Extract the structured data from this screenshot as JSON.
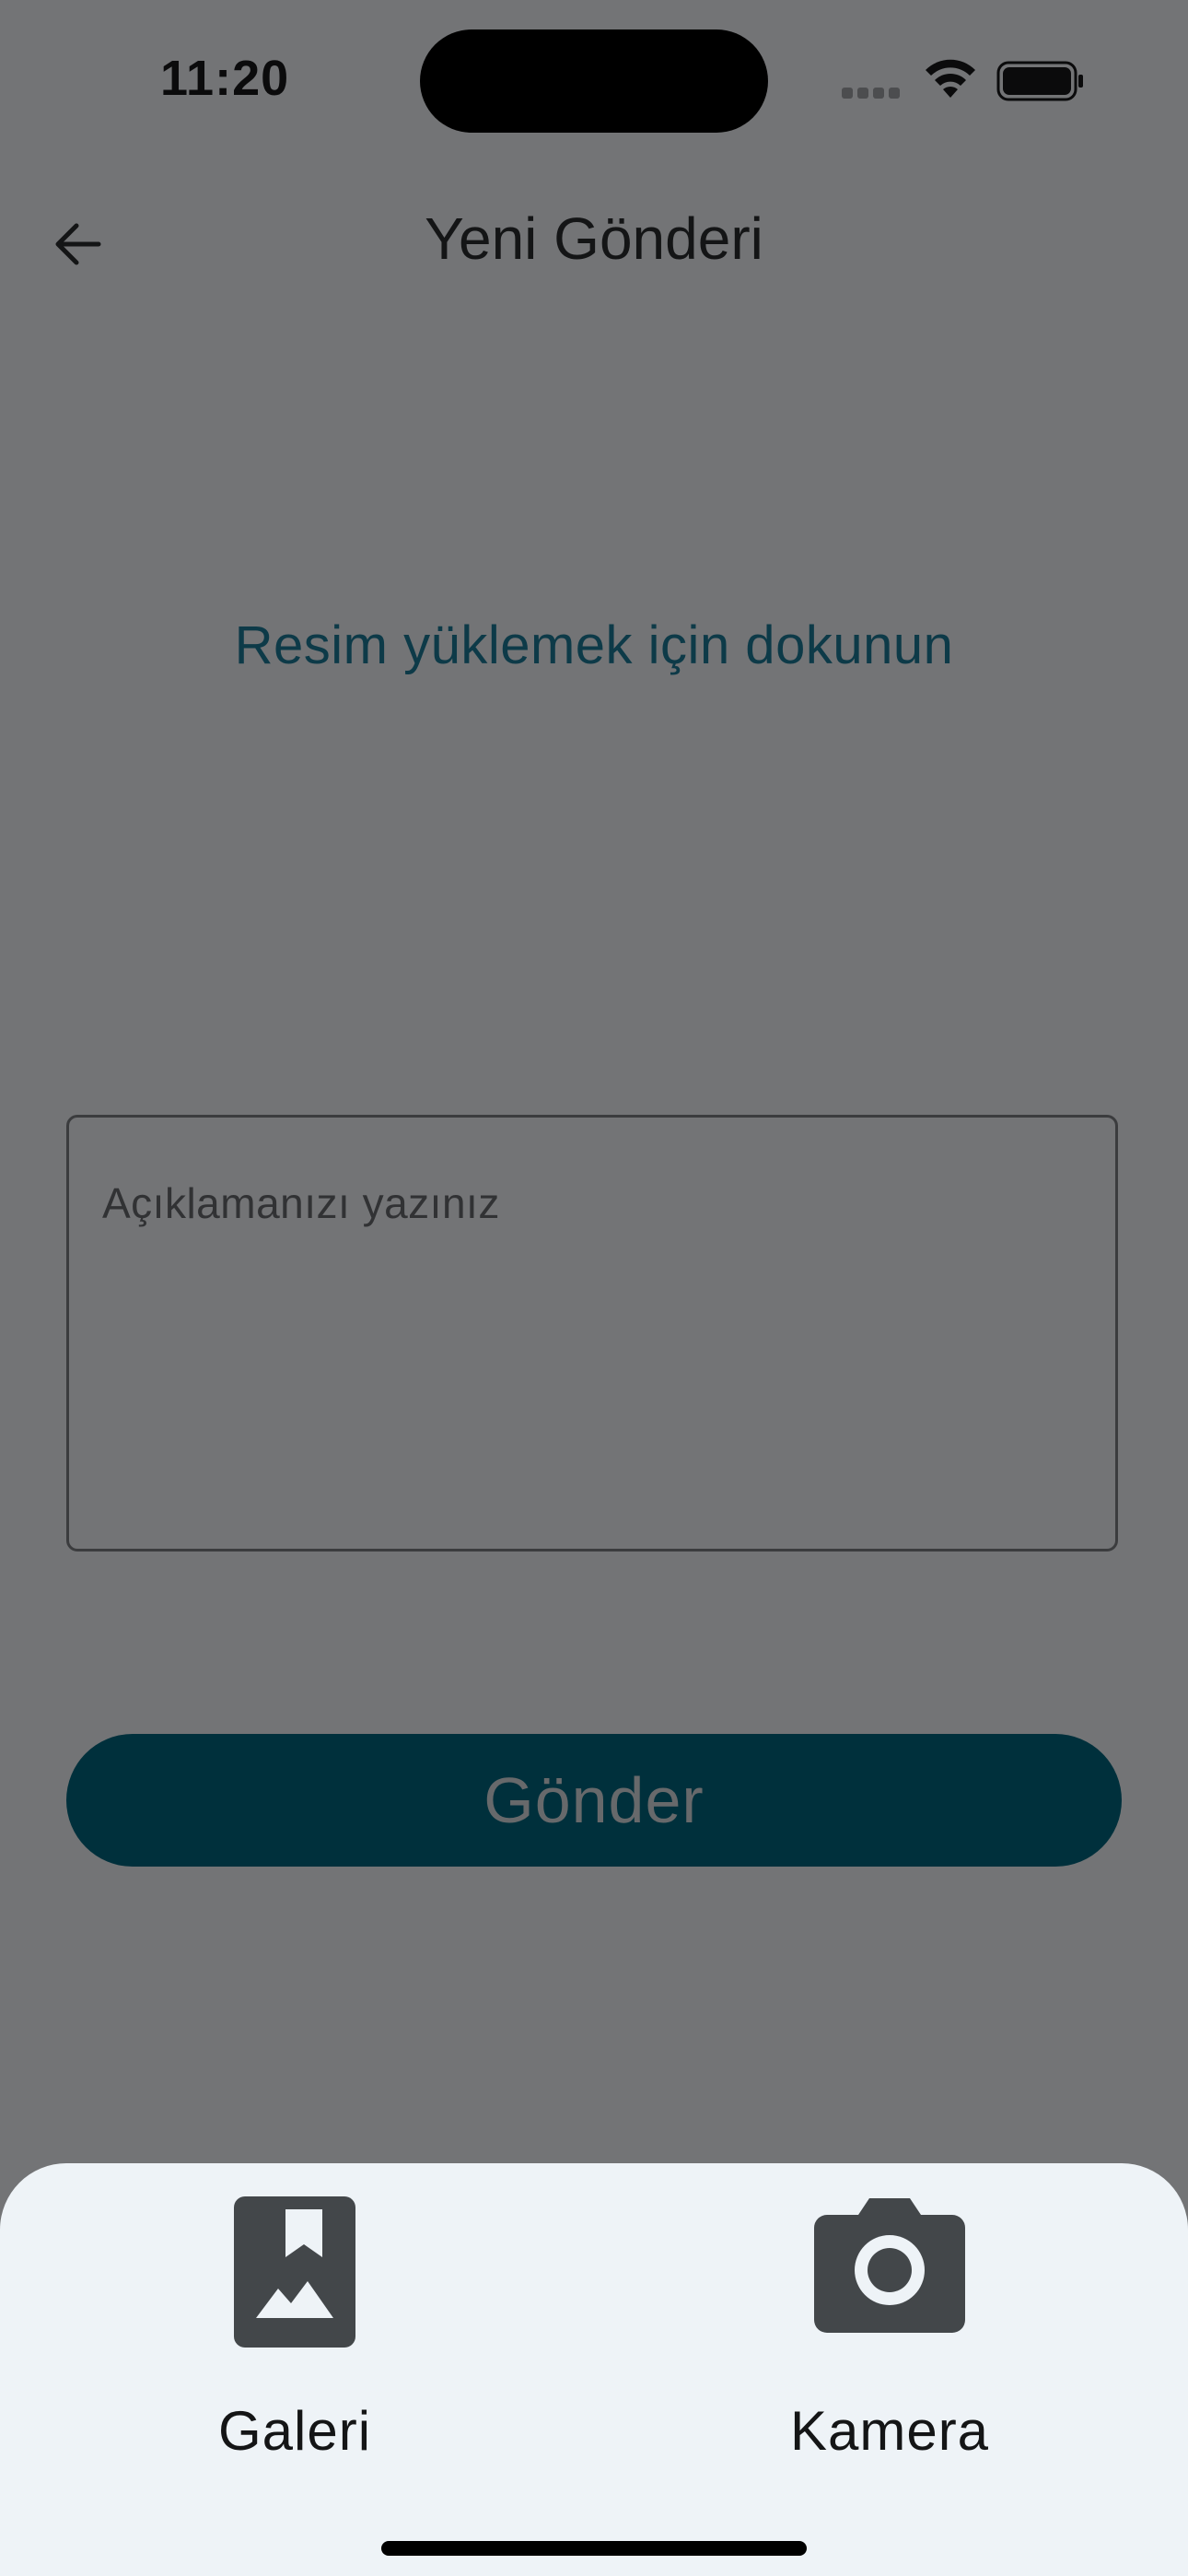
{
  "status_bar": {
    "time": "11:20"
  },
  "app_bar": {
    "title": "Yeni Gönderi",
    "back_icon": "arrow-left-icon"
  },
  "upload": {
    "prompt": "Resim yüklemek için dokunun"
  },
  "description": {
    "placeholder": "Açıklamanızı yazınız",
    "value": ""
  },
  "submit": {
    "label": "Gönder"
  },
  "bottom_sheet": {
    "options": [
      {
        "label": "Galeri",
        "icon": "gallery-icon"
      },
      {
        "label": "Kamera",
        "icon": "camera-icon"
      }
    ]
  },
  "colors": {
    "overlay_background": "#737476",
    "accent": "#00303c",
    "upload_text": "#0d3a48",
    "sheet_background": "#eef3f7",
    "icon": "#43474a"
  }
}
